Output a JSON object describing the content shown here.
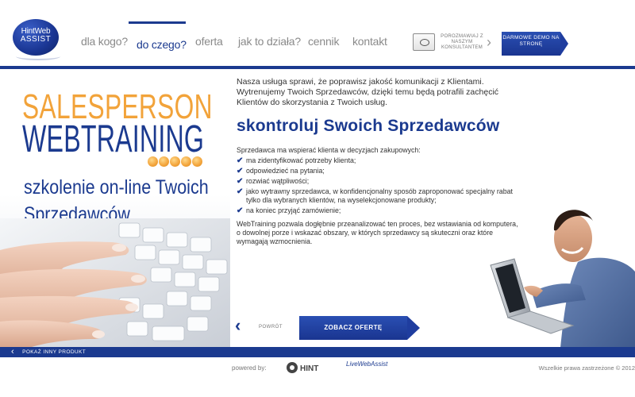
{
  "logo": {
    "line1": "HintWeb",
    "line2": "ASSIST"
  },
  "nav": [
    {
      "label": "dla kogo?"
    },
    {
      "label": "do czego?",
      "active": true
    },
    {
      "label": "oferta"
    },
    {
      "label": "jak to działa?"
    },
    {
      "label": "cennik"
    },
    {
      "label": "kontakt"
    }
  ],
  "consult": {
    "label": "POROZMAWIAJ Z NASZYM KONSULTANTEM",
    "icon": "chat-icon"
  },
  "demo_button": {
    "label": "DARMOWE DEMO NA STRONĘ"
  },
  "hero": {
    "title1": "SALESPERSON",
    "title2": "WEBTRAINING",
    "subtitle1": "szkolenie on-line Twoich",
    "subtitle2": "Sprzedawców"
  },
  "main": {
    "intro": "Nasza usługa sprawi, że poprawisz jakość komunikacji z Klientami. Wytrenujemy Twoich Sprzedawców, dzięki temu będą potrafili zachęcić Klientów do skorzystania z Twoich usług.",
    "heading": "skontroluj Swoich Sprzedawców",
    "lead": "Sprzedawca ma wspierać klienta w decyzjach zakupowych:",
    "items": [
      "ma zidentyfikować potrzeby klienta;",
      "odpowiedzieć na pytania;",
      "rozwiać wątpliwości;",
      "jako wytrawny sprzedawca, w konfidencjonalny sposób zaproponować specjalny rabat tylko dla wybranych klientów, na wyselekcjonowane produkty;",
      "na koniec przyjąć zamówienie;"
    ],
    "outro": "WebTraining pozwala dogłębnie przeanalizować ten proces, bez wstawiania od komputera, o dowolnej porze i wskazać obszary, w których sprzedawcy są skuteczni oraz które wymagają wzmocnienia."
  },
  "back": {
    "label": "POWRÓT"
  },
  "offer_button": {
    "label": "ZOBACZ OFERTĘ"
  },
  "footer": {
    "other_product": "POKAŻ INNY PRODUKT",
    "powered_by": "powered by:",
    "hint_logo": "HINT",
    "lwa_logo": "LiveWebAssist",
    "copyright": "Wszelkie prawa zastrzeżone © 2012"
  },
  "colors": {
    "brand_blue": "#1b3a8f",
    "accent_orange": "#f2a33a"
  }
}
